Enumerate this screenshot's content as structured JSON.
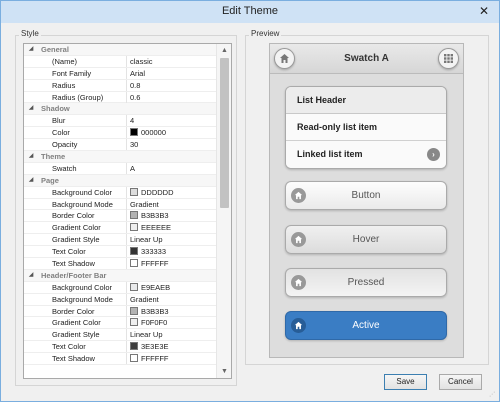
{
  "window": {
    "title": "Edit Theme",
    "close_glyph": "✕"
  },
  "style_group": {
    "label": "Style"
  },
  "preview_group": {
    "label": "Preview"
  },
  "properties": [
    {
      "kind": "cat",
      "name": "General"
    },
    {
      "kind": "prop",
      "name": "(Name)",
      "value": "classic"
    },
    {
      "kind": "prop",
      "name": "Font Family",
      "value": "Arial"
    },
    {
      "kind": "prop",
      "name": "Radius",
      "value": "0.8"
    },
    {
      "kind": "prop",
      "name": "Radius (Group)",
      "value": "0.6"
    },
    {
      "kind": "cat",
      "name": "Shadow"
    },
    {
      "kind": "prop",
      "name": "Blur",
      "value": "4"
    },
    {
      "kind": "prop",
      "name": "Color",
      "value": "000000",
      "swatch": "#000000"
    },
    {
      "kind": "prop",
      "name": "Opacity",
      "value": "30"
    },
    {
      "kind": "cat",
      "name": "Theme"
    },
    {
      "kind": "prop",
      "name": "Swatch",
      "value": "A"
    },
    {
      "kind": "cat",
      "name": "Page"
    },
    {
      "kind": "prop",
      "name": "Background Color",
      "value": "DDDDDD",
      "swatch": "#DDDDDD"
    },
    {
      "kind": "prop",
      "name": "Background Mode",
      "value": "Gradient"
    },
    {
      "kind": "prop",
      "name": "Border Color",
      "value": "B3B3B3",
      "swatch": "#B3B3B3"
    },
    {
      "kind": "prop",
      "name": "Gradient Color",
      "value": "EEEEEE",
      "swatch": "#EEEEEE"
    },
    {
      "kind": "prop",
      "name": "Gradient Style",
      "value": "Linear Up"
    },
    {
      "kind": "prop",
      "name": "Text Color",
      "value": "333333",
      "swatch": "#333333"
    },
    {
      "kind": "prop",
      "name": "Text Shadow",
      "value": "FFFFFF",
      "swatch": "#FFFFFF"
    },
    {
      "kind": "cat",
      "name": "Header/Footer Bar"
    },
    {
      "kind": "prop",
      "name": "Background Color",
      "value": "E9EAEB",
      "swatch": "#E9EAEB"
    },
    {
      "kind": "prop",
      "name": "Background Mode",
      "value": "Gradient"
    },
    {
      "kind": "prop",
      "name": "Border Color",
      "value": "B3B3B3",
      "swatch": "#B3B3B3"
    },
    {
      "kind": "prop",
      "name": "Gradient Color",
      "value": "F0F0F0",
      "swatch": "#F0F0F0"
    },
    {
      "kind": "prop",
      "name": "Gradient Style",
      "value": "Linear Up"
    },
    {
      "kind": "prop",
      "name": "Text Color",
      "value": "3E3E3E",
      "swatch": "#3E3E3E"
    },
    {
      "kind": "prop",
      "name": "Text Shadow",
      "value": "FFFFFF",
      "swatch": "#FFFFFF"
    }
  ],
  "preview": {
    "header_title": "Swatch A",
    "left_icon": "home-icon",
    "right_icon": "grid-icon",
    "list": {
      "header": "List Header",
      "readonly": "Read-only list item",
      "linked": "Linked list item",
      "linked_icon": "chevron-right-icon"
    },
    "buttons": {
      "normal": "Button",
      "hover": "Hover",
      "pressed": "Pressed",
      "active": "Active"
    },
    "active_color": "#3A7DC4"
  },
  "footer": {
    "save": "Save",
    "cancel": "Cancel"
  }
}
